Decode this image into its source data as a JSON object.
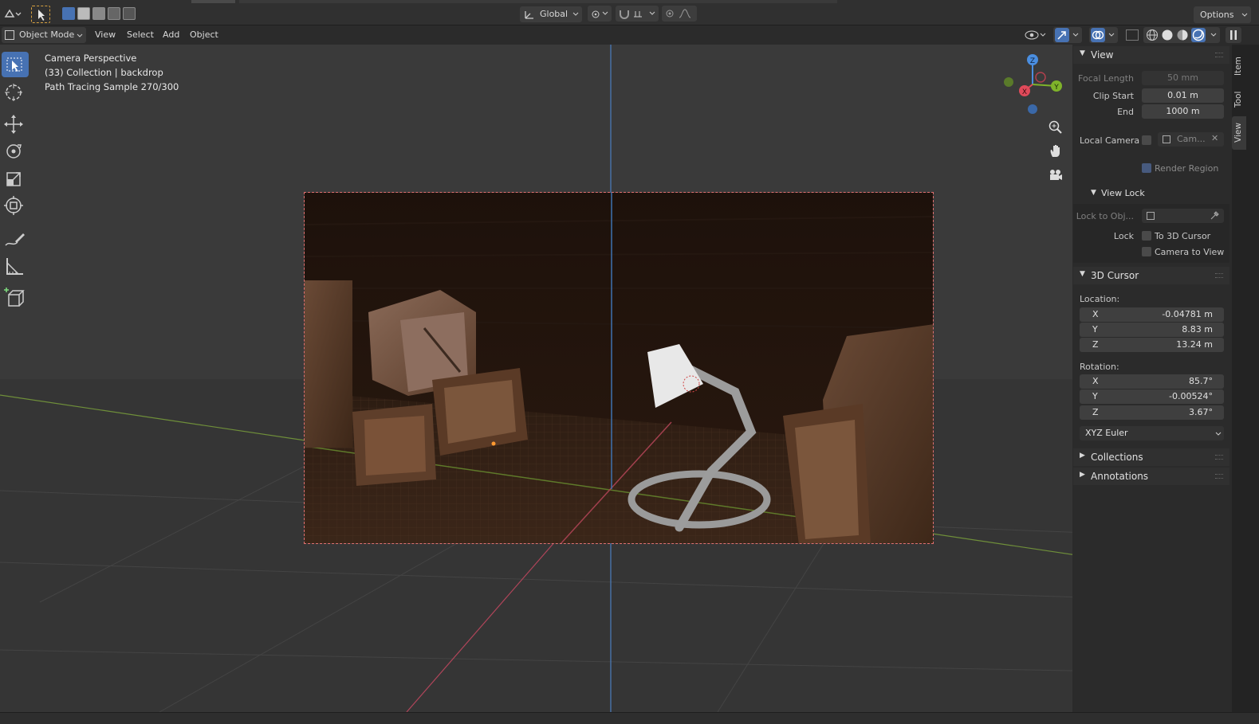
{
  "header": {
    "orientation_label": "Global",
    "options_label": "Options"
  },
  "header2": {
    "mode_label": "Object Mode",
    "menus": [
      "View",
      "Select",
      "Add",
      "Object"
    ]
  },
  "viewport": {
    "overlay_lines": [
      "Camera Perspective",
      "(33) Collection | backdrop",
      "Path Tracing Sample 270/300"
    ],
    "gizmo_axes": {
      "z": "Z",
      "y": "Y",
      "x": "X"
    }
  },
  "sidebar": {
    "tabs": [
      "Item",
      "Tool",
      "View"
    ],
    "view_panel": {
      "title": "View",
      "focal_length_label": "Focal Length",
      "focal_length_value": "50 mm",
      "clip_start_label": "Clip Start",
      "clip_start_value": "0.01 m",
      "clip_end_label": "End",
      "clip_end_value": "1000 m",
      "local_camera_label": "Local Camera",
      "local_camera_value": "Cam...",
      "render_region_label": "Render Region"
    },
    "view_lock": {
      "title": "View Lock",
      "lock_to_object_label": "Lock to Obj...",
      "lock_label": "Lock",
      "to_3d_cursor_label": "To 3D Cursor",
      "camera_to_view_label": "Camera to View"
    },
    "cursor_panel": {
      "title": "3D Cursor",
      "location_label": "Location:",
      "location": [
        {
          "axis": "X",
          "value": "-0.04781 m"
        },
        {
          "axis": "Y",
          "value": "8.83 m"
        },
        {
          "axis": "Z",
          "value": "13.24 m"
        }
      ],
      "rotation_label": "Rotation:",
      "rotation": [
        {
          "axis": "X",
          "value": "85.7°"
        },
        {
          "axis": "Y",
          "value": "-0.00524°"
        },
        {
          "axis": "Z",
          "value": "3.67°"
        }
      ],
      "rotation_mode": "XYZ Euler"
    },
    "collapsed_panels": [
      "Collections",
      "Annotations"
    ]
  },
  "colors": {
    "accent": "#4772b3",
    "axis_x": "#e04a5a",
    "axis_y": "#7fb32a",
    "axis_z": "#4a8ee0",
    "camera_frame": "#e07070"
  }
}
